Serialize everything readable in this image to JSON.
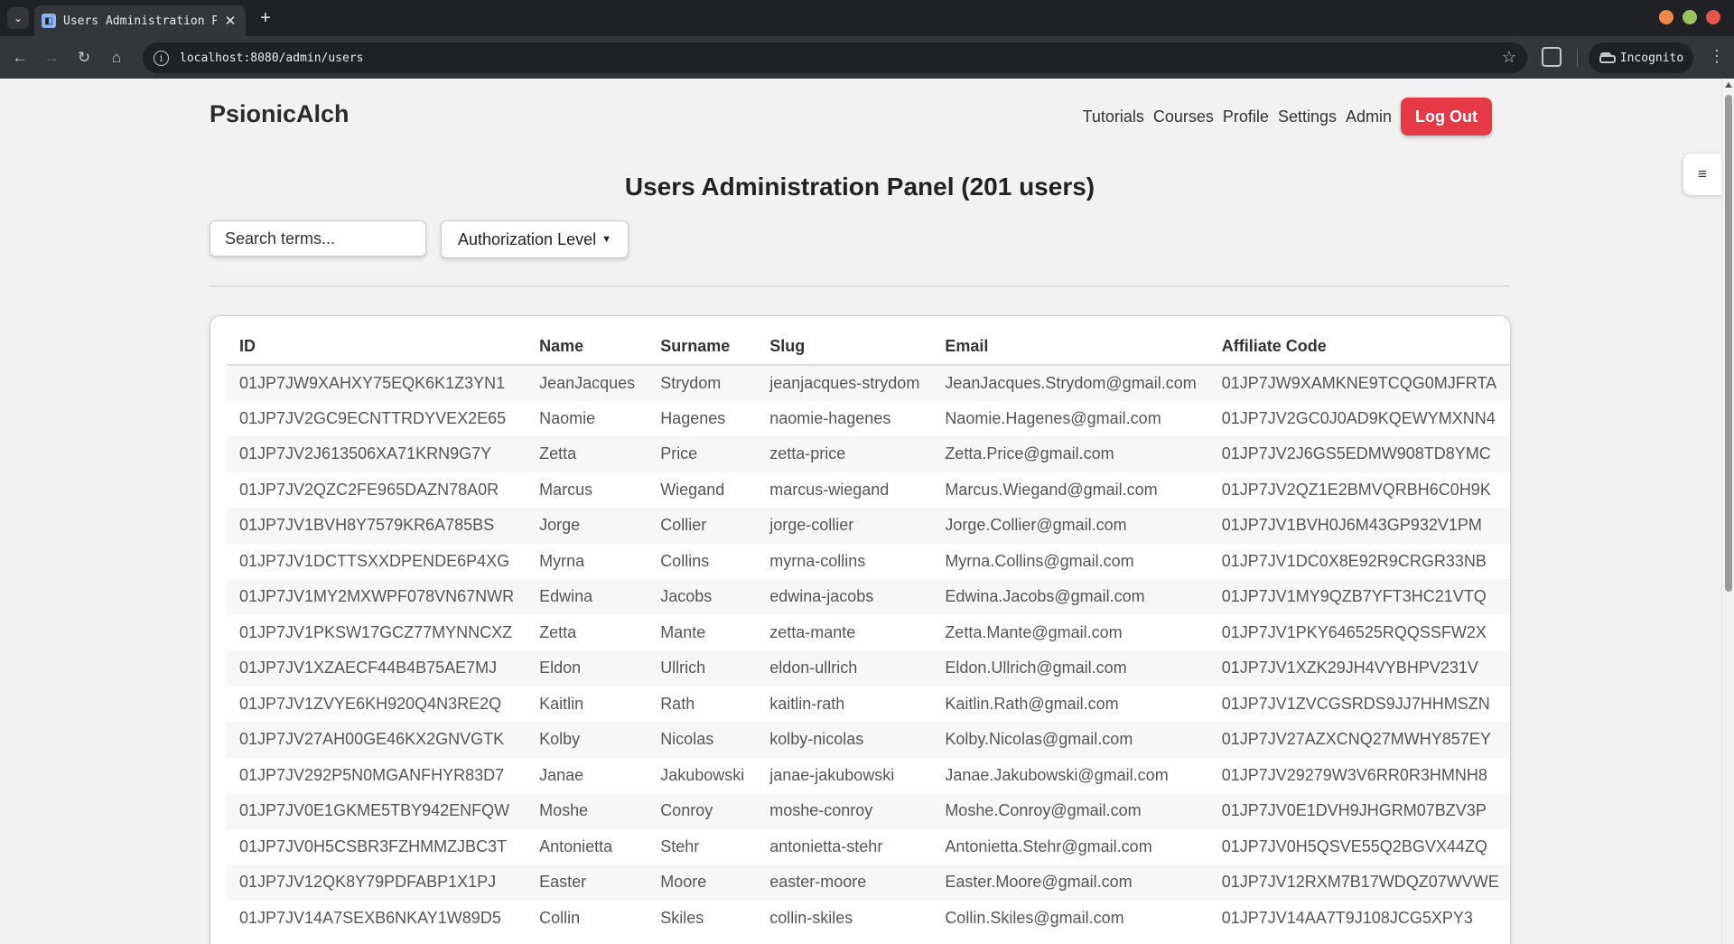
{
  "browser": {
    "tab_title": "Users Administration Panel",
    "url": "localhost:8080/admin/users",
    "incognito_label": "Incognito"
  },
  "header": {
    "brand": "PsionicAlch",
    "nav": [
      "Tutorials",
      "Courses",
      "Profile",
      "Settings",
      "Admin"
    ],
    "logout": "Log Out"
  },
  "main": {
    "title": "Users Administration Panel (201 users)",
    "search_placeholder": "Search terms...",
    "auth_select": "Authorization Level"
  },
  "table": {
    "columns": [
      "ID",
      "Name",
      "Surname",
      "Slug",
      "Email",
      "Affiliate Code"
    ],
    "rows": [
      [
        "01JP7JW9XAHXY75EQK6K1Z3YN1",
        "JeanJacques",
        "Strydom",
        "jeanjacques-strydom",
        "JeanJacques.Strydom@gmail.com",
        "01JP7JW9XAMKNE9TCQG0MJFRTA"
      ],
      [
        "01JP7JV2GC9ECNTTRDYVEX2E65",
        "Naomie",
        "Hagenes",
        "naomie-hagenes",
        "Naomie.Hagenes@gmail.com",
        "01JP7JV2GC0J0AD9KQEWYMXNN4"
      ],
      [
        "01JP7JV2J613506XA71KRN9G7Y",
        "Zetta",
        "Price",
        "zetta-price",
        "Zetta.Price@gmail.com",
        "01JP7JV2J6GS5EDMW908TD8YMC"
      ],
      [
        "01JP7JV2QZC2FE965DAZN78A0R",
        "Marcus",
        "Wiegand",
        "marcus-wiegand",
        "Marcus.Wiegand@gmail.com",
        "01JP7JV2QZ1E2BMVQRBH6C0H9K"
      ],
      [
        "01JP7JV1BVH8Y7579KR6A785BS",
        "Jorge",
        "Collier",
        "jorge-collier",
        "Jorge.Collier@gmail.com",
        "01JP7JV1BVH0J6M43GP932V1PM"
      ],
      [
        "01JP7JV1DCTTSXXDPENDE6P4XG",
        "Myrna",
        "Collins",
        "myrna-collins",
        "Myrna.Collins@gmail.com",
        "01JP7JV1DC0X8E92R9CRGR33NB"
      ],
      [
        "01JP7JV1MY2MXWPF078VN67NWR",
        "Edwina",
        "Jacobs",
        "edwina-jacobs",
        "Edwina.Jacobs@gmail.com",
        "01JP7JV1MY9QZB7YFT3HC21VTQ"
      ],
      [
        "01JP7JV1PKSW17GCZ77MYNNCXZ",
        "Zetta",
        "Mante",
        "zetta-mante",
        "Zetta.Mante@gmail.com",
        "01JP7JV1PKY646525RQQSSFW2X"
      ],
      [
        "01JP7JV1XZAECF44B4B75AE7MJ",
        "Eldon",
        "Ullrich",
        "eldon-ullrich",
        "Eldon.Ullrich@gmail.com",
        "01JP7JV1XZK29JH4VYBHPV231V"
      ],
      [
        "01JP7JV1ZVYE6KH920Q4N3RE2Q",
        "Kaitlin",
        "Rath",
        "kaitlin-rath",
        "Kaitlin.Rath@gmail.com",
        "01JP7JV1ZVCGSRDS9JJ7HHMSZN"
      ],
      [
        "01JP7JV27AH00GE46KX2GNVGTK",
        "Kolby",
        "Nicolas",
        "kolby-nicolas",
        "Kolby.Nicolas@gmail.com",
        "01JP7JV27AZXCNQ27MWHY857EY"
      ],
      [
        "01JP7JV292P5N0MGANFHYR83D7",
        "Janae",
        "Jakubowski",
        "janae-jakubowski",
        "Janae.Jakubowski@gmail.com",
        "01JP7JV29279W3V6RR0R3HMNH8"
      ],
      [
        "01JP7JV0E1GKME5TBY942ENFQW",
        "Moshe",
        "Conroy",
        "moshe-conroy",
        "Moshe.Conroy@gmail.com",
        "01JP7JV0E1DVH9JHGRM07BZV3P"
      ],
      [
        "01JP7JV0H5CSBR3FZHMMZJBC3T",
        "Antonietta",
        "Stehr",
        "antonietta-stehr",
        "Antonietta.Stehr@gmail.com",
        "01JP7JV0H5QSVE55Q2BGVX44ZQ"
      ],
      [
        "01JP7JV12QK8Y79PDFABP1X1PJ",
        "Easter",
        "Moore",
        "easter-moore",
        "Easter.Moore@gmail.com",
        "01JP7JV12RXM7B17WDQZ07WVWE"
      ],
      [
        "01JP7JV14A7SEXB6NKAY1W89D5",
        "Collin",
        "Skiles",
        "collin-skiles",
        "Collin.Skiles@gmail.com",
        "01JP7JV14AA7T9J108JCG5XPY3"
      ]
    ]
  },
  "colors": {
    "logout_button": "#e63946",
    "page_background": "#f2f2f2",
    "browser_chrome": "#202124"
  },
  "icons": {
    "tab_menu": "chevron-down-icon",
    "back": "arrow-left-icon",
    "forward": "arrow-right-icon",
    "reload": "reload-icon",
    "home": "home-icon",
    "site_info": "info-icon",
    "bookmark": "star-icon",
    "extensions": "puzzle-icon",
    "incognito": "incognito-icon",
    "browser_menu": "kebab-menu-icon",
    "sidebar_toggle": "hamburger-icon"
  }
}
